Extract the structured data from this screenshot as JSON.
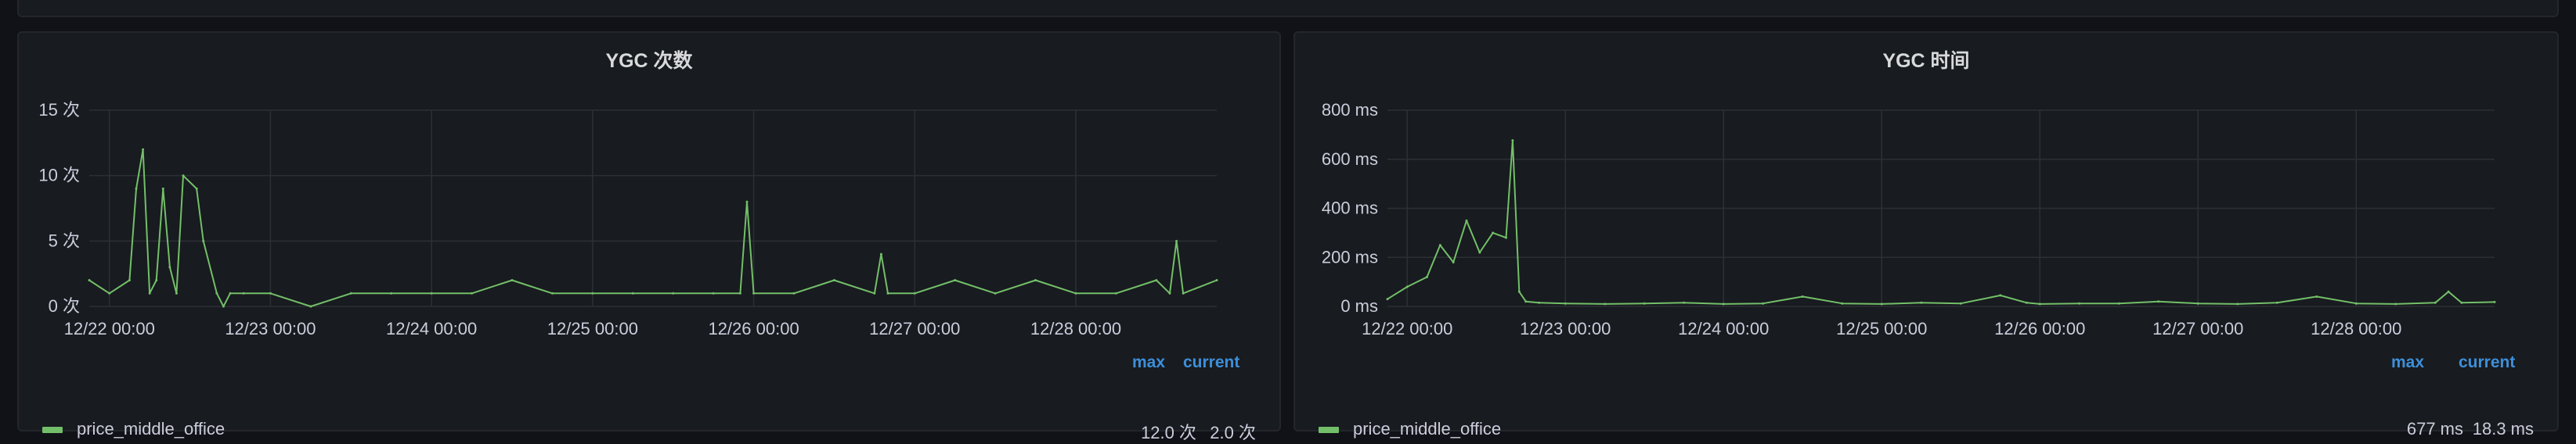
{
  "panels": [
    {
      "title": "YGC 次数",
      "legend": {
        "max_label": "max",
        "current_label": "current",
        "series_name": "price_middle_office",
        "max_value": "12.0 次",
        "current_value": "2.0 次"
      }
    },
    {
      "title": "YGC 时间",
      "legend": {
        "max_label": "max",
        "current_label": "current",
        "series_name": "price_middle_office",
        "max_value": "677 ms",
        "current_value": "18.3 ms"
      }
    }
  ],
  "colors": {
    "series": "#73bf69",
    "grid": "#2c3036",
    "background": "#181b1f",
    "legend_header": "#3d8fd9"
  },
  "chart_data": [
    {
      "type": "line",
      "title": "YGC 次数",
      "x_ticks": [
        "12/22 00:00",
        "12/23 00:00",
        "12/24 00:00",
        "12/25 00:00",
        "12/26 00:00",
        "12/27 00:00",
        "12/28 00:00"
      ],
      "y_ticks": [
        "0 次",
        "5 次",
        "10 次",
        "15 次"
      ],
      "ylim": [
        0,
        15
      ],
      "x_start": "12/21 21:00",
      "x_end": "12/28 21:00",
      "grid": true,
      "series": [
        {
          "name": "price_middle_office",
          "x": [
            "12/21 21:00",
            "12/22 00:00",
            "12/22 03:00",
            "12/22 04:00",
            "12/22 05:00",
            "12/22 06:00",
            "12/22 07:00",
            "12/22 08:00",
            "12/22 09:00",
            "12/22 10:00",
            "12/22 11:00",
            "12/22 13:00",
            "12/22 14:00",
            "12/22 16:00",
            "12/22 17:00",
            "12/22 18:00",
            "12/22 20:00",
            "12/23 00:00",
            "12/23 06:00",
            "12/23 12:00",
            "12/23 18:00",
            "12/24 00:00",
            "12/24 06:00",
            "12/24 12:00",
            "12/24 18:00",
            "12/25 00:00",
            "12/25 06:00",
            "12/25 12:00",
            "12/25 18:00",
            "12/25 22:00",
            "12/25 23:00",
            "12/26 00:00",
            "12/26 06:00",
            "12/26 12:00",
            "12/26 18:00",
            "12/26 19:00",
            "12/26 20:00",
            "12/27 00:00",
            "12/27 06:00",
            "12/27 12:00",
            "12/27 18:00",
            "12/28 00:00",
            "12/28 06:00",
            "12/28 12:00",
            "12/28 14:00",
            "12/28 15:00",
            "12/28 16:00",
            "12/28 21:00"
          ],
          "values": [
            2,
            1,
            2,
            9,
            12,
            1,
            2,
            9,
            3,
            1,
            10,
            9,
            5,
            1,
            0,
            1,
            1,
            1,
            0,
            1,
            1,
            1,
            1,
            2,
            1,
            1,
            1,
            1,
            1,
            1,
            8,
            1,
            1,
            2,
            1,
            4,
            1,
            1,
            2,
            1,
            2,
            1,
            1,
            2,
            1,
            5,
            1,
            2
          ]
        }
      ]
    },
    {
      "type": "line",
      "title": "YGC 时间",
      "x_ticks": [
        "12/22 00:00",
        "12/23 00:00",
        "12/24 00:00",
        "12/25 00:00",
        "12/26 00:00",
        "12/27 00:00",
        "12/28 00:00"
      ],
      "y_ticks": [
        "0 ms",
        "200 ms",
        "400 ms",
        "600 ms",
        "800 ms"
      ],
      "ylim": [
        0,
        800
      ],
      "x_start": "12/21 21:00",
      "x_end": "12/28 21:00",
      "grid": true,
      "series": [
        {
          "name": "price_middle_office",
          "x": [
            "12/21 21:00",
            "12/22 00:00",
            "12/22 03:00",
            "12/22 05:00",
            "12/22 07:00",
            "12/22 09:00",
            "12/22 11:00",
            "12/22 13:00",
            "12/22 15:00",
            "12/22 16:00",
            "12/22 17:00",
            "12/22 18:00",
            "12/22 20:00",
            "12/23 00:00",
            "12/23 06:00",
            "12/23 12:00",
            "12/23 18:00",
            "12/24 00:00",
            "12/24 06:00",
            "12/24 12:00",
            "12/24 18:00",
            "12/25 00:00",
            "12/25 06:00",
            "12/25 12:00",
            "12/25 18:00",
            "12/25 22:00",
            "12/26 00:00",
            "12/26 06:00",
            "12/26 12:00",
            "12/26 18:00",
            "12/27 00:00",
            "12/27 06:00",
            "12/27 12:00",
            "12/27 18:00",
            "12/28 00:00",
            "12/28 06:00",
            "12/28 12:00",
            "12/28 14:00",
            "12/28 16:00",
            "12/28 21:00"
          ],
          "values": [
            30,
            80,
            120,
            250,
            180,
            350,
            220,
            300,
            280,
            677,
            60,
            20,
            15,
            12,
            10,
            12,
            15,
            10,
            12,
            40,
            12,
            10,
            15,
            12,
            45,
            15,
            10,
            12,
            12,
            20,
            12,
            10,
            15,
            40,
            12,
            10,
            15,
            60,
            15,
            18
          ]
        }
      ]
    }
  ]
}
